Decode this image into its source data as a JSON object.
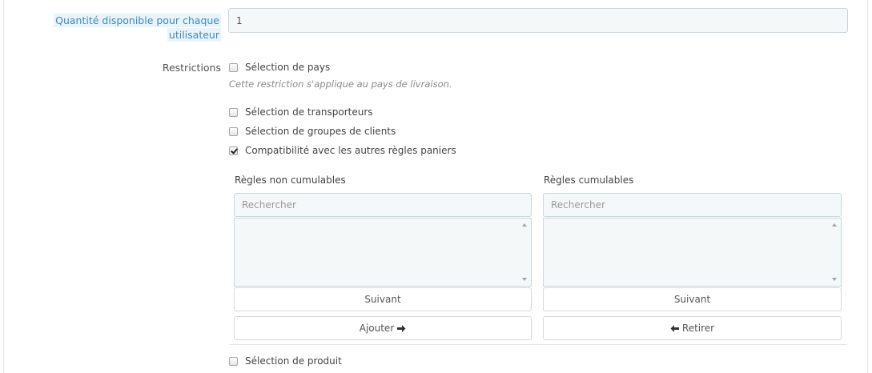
{
  "quantity": {
    "label_line1": "Quantité disponible pour chaque",
    "label_line2": "utilisateur",
    "value": "1"
  },
  "restrictions": {
    "label": "Restrictions",
    "country": {
      "label": "Sélection de pays",
      "checked": false,
      "help": "Cette restriction s'applique au pays de livraison."
    },
    "carriers": {
      "label": "Sélection de transporteurs",
      "checked": false
    },
    "groups": {
      "label": "Sélection de groupes de clients",
      "checked": false
    },
    "compat": {
      "label": "Compatibilité avec les autres règles paniers",
      "checked": true
    },
    "product": {
      "label": "Sélection de produit",
      "checked": false
    }
  },
  "non_cumulative": {
    "title": "Règles non cumulables",
    "search_placeholder": "Rechercher",
    "next_label": "Suivant",
    "action_label": "Ajouter",
    "action_icon": "arrow-right-icon"
  },
  "cumulative": {
    "title": "Règles cumulables",
    "search_placeholder": "Rechercher",
    "next_label": "Suivant",
    "action_label": "Retirer",
    "action_icon": "arrow-left-icon"
  }
}
